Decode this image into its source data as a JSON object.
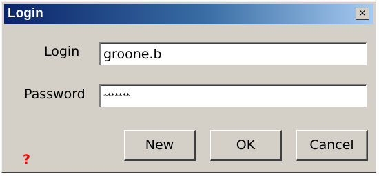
{
  "window": {
    "title": "Login",
    "close_symbol": "×"
  },
  "form": {
    "login_label": "Login",
    "login_value": "groone.b",
    "password_label": "Password",
    "password_value": "*******"
  },
  "buttons": {
    "new_label": "New",
    "ok_label": "OK",
    "cancel_label": "Cancel"
  },
  "help": {
    "symbol": "?",
    "icon": "help-icon",
    "color": "#ff0000"
  },
  "colors": {
    "titlebar_start": "#0a246a",
    "titlebar_end": "#a6caf0",
    "face": "#d4d0c8"
  }
}
